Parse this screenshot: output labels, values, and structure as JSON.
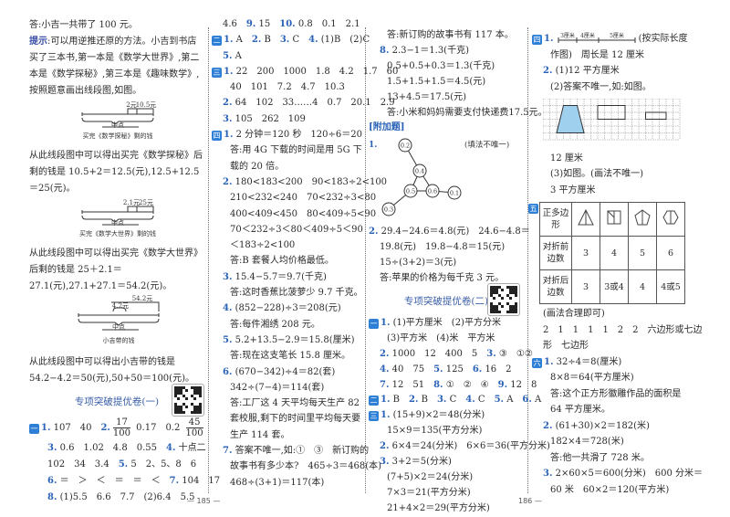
{
  "pages": {
    "left": "185",
    "right": "186"
  },
  "colors": {
    "accent": "#2a62b8",
    "marker": "#2e7fd6",
    "title": "#3a5fa8",
    "fill": "#9fd0ee"
  },
  "columns": [
    {
      "items": [
        {
          "type": "line",
          "segs": [
            {
              "t": "答:小吉一共带了 100 元。"
            }
          ]
        },
        {
          "type": "line",
          "cls": "wrap",
          "segs": [
            {
              "h": "提示"
            },
            {
              "t": ":可以用逆推还原的方法。小吉到书店买了三本书,第一本是《数学大世界》,第二本是《数学探秘》,第三本是《趣味数学》,按照题意画出线段图,如图。"
            }
          ]
        },
        {
          "type": "seg",
          "a": "2元",
          "b": "10.5元",
          "mid": "中点",
          "cap": "买完《数学探秘》剩的钱"
        },
        {
          "type": "line",
          "cls": "wrap",
          "segs": [
            {
              "t": "从此线段图中可以得出买完《数学探秘》后剩的钱是 10.5+2＝12.5(元),12.5+12.5＝25(元)。"
            }
          ]
        },
        {
          "type": "seg",
          "a": "2.1元",
          "b": "25元",
          "mid": "中点",
          "cap": "买完《数学大世界》剩的钱"
        },
        {
          "type": "line",
          "cls": "wrap",
          "segs": [
            {
              "t": "从此线段图中可以得出买完《数学大世界》后剩的钱是 25＋2.1＝27.1(元),27.1+27.1＝54.2(元)。"
            }
          ]
        },
        {
          "type": "seg3",
          "a": "54.2元",
          "b": "4.2元",
          "mid": "中点",
          "cap": "小吉带的钱"
        },
        {
          "type": "line",
          "cls": "wrap",
          "segs": [
            {
              "t": "从此线段图中可以得出小吉带的钱是 54.2−4.2＝50(元),50+50＝100(元)。"
            }
          ]
        },
        {
          "type": "title",
          "text": "专项突破提优卷(一)"
        },
        {
          "type": "line",
          "cls": "fracline",
          "segs": [
            {
              "m": "一"
            },
            {
              "n": "1."
            },
            {
              "t": " 107　40　"
            },
            {
              "n": "2."
            },
            {
              "f": [
                "17",
                "100"
              ]
            },
            {
              "t": " 0.17　0.2 "
            },
            {
              "f": [
                "45",
                "100"
              ]
            }
          ]
        },
        {
          "type": "line",
          "cls": "ind2",
          "segs": [
            {
              "n": "3."
            },
            {
              "t": " 0.6　1.02　4.8　0.55　"
            },
            {
              "n": "4."
            },
            {
              "t": " 十点二"
            }
          ]
        },
        {
          "type": "line",
          "cls": "ind2",
          "segs": [
            {
              "t": "102　34　3.4　"
            },
            {
              "n": "5."
            },
            {
              "t": " 5　2、5、8　6"
            }
          ]
        },
        {
          "type": "line",
          "cls": "ind2",
          "segs": [
            {
              "n": "6."
            },
            {
              "t": " ＝　＞　＜　＝　＝　＜　"
            },
            {
              "n": "7."
            },
            {
              "t": " 104　17"
            }
          ]
        },
        {
          "type": "line",
          "cls": "ind2",
          "segs": [
            {
              "n": "8."
            },
            {
              "t": " (1)5.5　6.6　7.7　(2)6.4　5.5"
            }
          ]
        }
      ]
    },
    {
      "items": [
        {
          "type": "line",
          "cls": "ind",
          "segs": [
            {
              "t": "4.6　"
            },
            {
              "n": "9."
            },
            {
              "t": " 15　"
            },
            {
              "n": "10."
            },
            {
              "t": " 0.8　0.1　2.1"
            }
          ]
        },
        {
          "type": "line",
          "segs": [
            {
              "m": "二"
            },
            {
              "n": "1."
            },
            {
              "t": " A　"
            },
            {
              "n": "2."
            },
            {
              "t": " B　"
            },
            {
              "n": "3."
            },
            {
              "t": " C　"
            },
            {
              "n": "4."
            },
            {
              "t": " (1)B　(2)C"
            }
          ]
        },
        {
          "type": "line",
          "cls": "ind",
          "segs": [
            {
              "n": "5."
            },
            {
              "t": " A"
            }
          ]
        },
        {
          "type": "line",
          "segs": [
            {
              "m": "三"
            },
            {
              "n": "1."
            },
            {
              "t": " 22　200　1000　1.8　4.2　1.7　60"
            }
          ]
        },
        {
          "type": "line",
          "cls": "ind2",
          "segs": [
            {
              "t": "40　101　7.2　4.7　10.3"
            }
          ]
        },
        {
          "type": "line",
          "cls": "ind",
          "segs": [
            {
              "n": "2."
            },
            {
              "t": " 64　102　33……4　0.7　20.1　2.9"
            }
          ]
        },
        {
          "type": "line",
          "cls": "ind",
          "segs": [
            {
              "n": "3."
            },
            {
              "t": " 105　262　109"
            }
          ]
        },
        {
          "type": "line",
          "segs": [
            {
              "m": "四"
            },
            {
              "n": "1."
            },
            {
              "t": " 2 分钟＝120 秒　120÷6＝20"
            }
          ]
        },
        {
          "type": "line",
          "cls": "ind2 wrap",
          "segs": [
            {
              "t": "答:用 4G 下载的时间是用 5G 下载的 20 倍。"
            }
          ]
        },
        {
          "type": "line",
          "cls": "ind",
          "segs": [
            {
              "n": "2."
            },
            {
              "t": " 180<183<200　90<183÷2<100"
            }
          ]
        },
        {
          "type": "line",
          "cls": "ind2",
          "segs": [
            {
              "t": "210<232<240　70<232÷3<80"
            }
          ]
        },
        {
          "type": "line",
          "cls": "ind2",
          "segs": [
            {
              "t": "400<409<450　80<409÷5<90"
            }
          ]
        },
        {
          "type": "line",
          "cls": "ind2 wrap",
          "segs": [
            {
              "t": "70＜232÷3＜80＜409÷5＜90＜183÷2<100"
            }
          ]
        },
        {
          "type": "line",
          "cls": "ind2",
          "segs": [
            {
              "t": "答:B 套餐人均价格最低。"
            }
          ]
        },
        {
          "type": "line",
          "cls": "ind",
          "segs": [
            {
              "n": "3."
            },
            {
              "t": " 15.4−5.7＝9.7(千克)"
            }
          ]
        },
        {
          "type": "line",
          "cls": "ind2",
          "segs": [
            {
              "t": "答:这时香蕉比菠萝少 9.7 千克。"
            }
          ]
        },
        {
          "type": "line",
          "cls": "ind",
          "segs": [
            {
              "n": "4."
            },
            {
              "t": " (852−228)÷3＝208(元)"
            }
          ]
        },
        {
          "type": "line",
          "cls": "ind2",
          "segs": [
            {
              "t": "答:每件湘绣 208 元。"
            }
          ]
        },
        {
          "type": "line",
          "cls": "ind",
          "segs": [
            {
              "n": "5."
            },
            {
              "t": " 5.2+13.5−2.9＝15.8(厘米)"
            }
          ]
        },
        {
          "type": "line",
          "cls": "ind2",
          "segs": [
            {
              "t": "答:现在这支笔长 15.8 厘米。"
            }
          ]
        },
        {
          "type": "line",
          "cls": "ind",
          "segs": [
            {
              "n": "6."
            },
            {
              "t": " (670−342)÷4＝82(套)"
            }
          ]
        },
        {
          "type": "line",
          "cls": "ind2",
          "segs": [
            {
              "t": "342÷(7−4)＝114(套)"
            }
          ]
        },
        {
          "type": "line",
          "cls": "ind2 wrap",
          "segs": [
            {
              "t": "答:工厂这 4 天平均每天生产 82 套校服,剩下的时间里平均每天要生产 114 套。"
            }
          ]
        },
        {
          "type": "line",
          "cls": "ind",
          "segs": [
            {
              "n": "7."
            },
            {
              "t": " 答案不唯一,如:①　③　新订购的"
            }
          ]
        },
        {
          "type": "line",
          "cls": "ind2",
          "segs": [
            {
              "t": "故事书有多少本?　465÷3＝468(本)"
            }
          ]
        },
        {
          "type": "line",
          "cls": "ind2",
          "segs": [
            {
              "t": "468÷(3+1)＝117(本)"
            }
          ]
        }
      ]
    },
    {
      "items": [
        {
          "type": "line",
          "cls": "ind2",
          "segs": [
            {
              "t": "答:新订购的故事书有 117 本。"
            }
          ]
        },
        {
          "type": "line",
          "cls": "ind",
          "segs": [
            {
              "n": "8."
            },
            {
              "t": " 2.3−1＝1.3(千克)"
            }
          ]
        },
        {
          "type": "line",
          "cls": "ind2",
          "segs": [
            {
              "t": "0.5+0.5+0.3＝1.3(千克)"
            }
          ]
        },
        {
          "type": "line",
          "cls": "ind2",
          "segs": [
            {
              "t": "1.5+1.5+1.5＝4.5(元)"
            }
          ]
        },
        {
          "type": "line",
          "cls": "ind2",
          "segs": [
            {
              "t": "13+4.5＝17.5(元)"
            }
          ]
        },
        {
          "type": "line",
          "cls": "ind2",
          "segs": [
            {
              "t": "答:小米和妈妈需要支付快递费17.5元。"
            }
          ]
        },
        {
          "type": "line",
          "segs": [
            {
              "b": "[附加题]"
            }
          ]
        },
        {
          "type": "tree",
          "num": "1.",
          "note": "(填法不唯一)",
          "nodes": [
            "0.2",
            "0.4",
            "0.5",
            "0.6",
            "0.1",
            "0.3"
          ]
        },
        {
          "type": "line",
          "segs": [
            {
              "n": "2."
            },
            {
              "t": " 29.4−24.6＝4.8(元)　24.6−4.8＝"
            }
          ]
        },
        {
          "type": "line",
          "cls": "ind",
          "segs": [
            {
              "t": "19.8(元)　19.8−4.8＝15(元)"
            }
          ]
        },
        {
          "type": "line",
          "cls": "ind",
          "segs": [
            {
              "t": "15÷(3+2)＝3(元)"
            }
          ]
        },
        {
          "type": "line",
          "cls": "ind",
          "segs": [
            {
              "t": "答:苹果的价格为每千克 3 元。"
            }
          ]
        },
        {
          "type": "title",
          "text": "专项突破提优卷(二)"
        },
        {
          "type": "line",
          "segs": [
            {
              "m": "一"
            },
            {
              "n": "1."
            },
            {
              "t": " (1)平方厘米　(2)平方分米"
            }
          ]
        },
        {
          "type": "line",
          "cls": "ind2",
          "segs": [
            {
              "t": "(3)平方米　(4)米　平方米"
            }
          ]
        },
        {
          "type": "line",
          "cls": "ind",
          "segs": [
            {
              "n": "2."
            },
            {
              "t": " 1000　12　400　5　"
            },
            {
              "n": "3."
            },
            {
              "t": " ③　①②"
            }
          ]
        },
        {
          "type": "line",
          "cls": "ind",
          "segs": [
            {
              "n": "4."
            },
            {
              "t": " 40　75　"
            },
            {
              "n": "5."
            },
            {
              "t": " 125　"
            },
            {
              "n": "6."
            },
            {
              "t": " 16　2"
            }
          ]
        },
        {
          "type": "line",
          "cls": "ind",
          "segs": [
            {
              "n": "7."
            },
            {
              "t": " 12　51　"
            },
            {
              "n": "8."
            },
            {
              "t": " ①　②　④　"
            },
            {
              "n": "9."
            },
            {
              "t": " 12　8"
            }
          ]
        },
        {
          "type": "line",
          "segs": [
            {
              "m": "二"
            },
            {
              "n": "1."
            },
            {
              "t": " B　"
            },
            {
              "n": "2."
            },
            {
              "t": " B　"
            },
            {
              "n": "3."
            },
            {
              "t": " C　"
            },
            {
              "n": "4."
            },
            {
              "t": " C　"
            },
            {
              "n": "5."
            },
            {
              "t": " A　"
            },
            {
              "n": "6."
            },
            {
              "t": " A"
            }
          ]
        },
        {
          "type": "line",
          "segs": [
            {
              "m": "三"
            },
            {
              "n": "1."
            },
            {
              "t": " (15+9)×2＝48(分米)"
            }
          ]
        },
        {
          "type": "line",
          "cls": "ind2",
          "segs": [
            {
              "t": "15×9＝135(平方分米)"
            }
          ]
        },
        {
          "type": "line",
          "cls": "ind",
          "segs": [
            {
              "n": "2."
            },
            {
              "t": " 6×4＝24(分米)　6×6＝36(平方分米)"
            }
          ]
        },
        {
          "type": "line",
          "cls": "ind",
          "segs": [
            {
              "n": "3."
            },
            {
              "t": " 3+2＝5(分米)"
            }
          ]
        },
        {
          "type": "line",
          "cls": "ind2",
          "segs": [
            {
              "t": "(7+5)×2＝24(分米)"
            }
          ]
        },
        {
          "type": "line",
          "cls": "ind2",
          "segs": [
            {
              "t": "7×3＝21(平方分米)"
            }
          ]
        },
        {
          "type": "line",
          "cls": "ind2",
          "segs": [
            {
              "t": "21+4×2＝29(平方分米)"
            }
          ]
        }
      ]
    },
    {
      "items": [
        {
          "type": "ruler",
          "m": "四",
          "num": "1.",
          "labels": [
            "3厘米",
            "4厘米",
            "5厘米"
          ],
          "tail": "(按实际长度"
        },
        {
          "type": "line",
          "cls": "ind2",
          "segs": [
            {
              "t": "作图)　周长是 12 厘米"
            }
          ]
        },
        {
          "type": "line",
          "cls": "ind",
          "segs": [
            {
              "n": "2."
            },
            {
              "t": " (1)12 平方厘米"
            }
          ]
        },
        {
          "type": "line",
          "cls": "ind2",
          "segs": [
            {
              "t": "(2)答案不唯一,如:如图。"
            }
          ]
        },
        {
          "type": "grid"
        },
        {
          "type": "line",
          "cls": "ind2",
          "segs": [
            {
              "t": "12 厘米"
            }
          ]
        },
        {
          "type": "line",
          "cls": "ind2",
          "segs": [
            {
              "t": "(3)如图。(画法不唯一)"
            }
          ]
        },
        {
          "type": "line",
          "cls": "ind2",
          "segs": [
            {
              "t": "3 平方厘米"
            }
          ]
        },
        {
          "type": "table",
          "m": "五",
          "head": "正多边形",
          "rows": [
            {
              "label": "对折前边数",
              "vals": [
                "3",
                "4",
                "5",
                "6"
              ]
            },
            {
              "label": "对折后边数",
              "vals": [
                "3",
                "3或4",
                "4",
                "4或5"
              ]
            }
          ]
        },
        {
          "type": "line",
          "cls": "ind",
          "segs": [
            {
              "t": "(画法合理即可)"
            }
          ]
        },
        {
          "type": "line",
          "cls": "ind",
          "segs": [
            {
              "t": "2　1　1　1　1　2　2　六边形或七边"
            }
          ]
        },
        {
          "type": "line",
          "cls": "ind",
          "segs": [
            {
              "t": "形　七边形"
            }
          ]
        },
        {
          "type": "line",
          "segs": [
            {
              "m": "六"
            },
            {
              "n": "1."
            },
            {
              "t": " 32÷4＝8(厘米)"
            }
          ]
        },
        {
          "type": "line",
          "cls": "ind2",
          "segs": [
            {
              "t": "8×8＝64(平方厘米)"
            }
          ]
        },
        {
          "type": "line",
          "cls": "ind2",
          "segs": [
            {
              "t": "答:这个正方形徽雕作品的面积是"
            }
          ]
        },
        {
          "type": "line",
          "cls": "ind2",
          "segs": [
            {
              "t": "64 平方厘米。"
            }
          ]
        },
        {
          "type": "line",
          "cls": "ind",
          "segs": [
            {
              "n": "2."
            },
            {
              "t": " (61+30)×2＝182(米)"
            }
          ]
        },
        {
          "type": "line",
          "cls": "ind2",
          "segs": [
            {
              "t": "182×4＝728(米)"
            }
          ]
        },
        {
          "type": "line",
          "cls": "ind2",
          "segs": [
            {
              "t": "答:他一共滑了 728 米。"
            }
          ]
        },
        {
          "type": "line",
          "cls": "ind",
          "segs": [
            {
              "n": "3."
            },
            {
              "t": " 2×60×5＝600(分米)　600 分米＝"
            }
          ]
        },
        {
          "type": "line",
          "cls": "ind2",
          "segs": [
            {
              "t": "60 米　60×2＝120(平方米)"
            }
          ]
        }
      ]
    }
  ]
}
